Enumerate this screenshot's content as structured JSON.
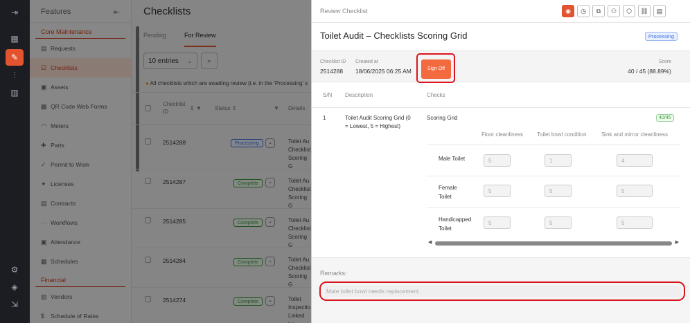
{
  "sidebar_features": {
    "title": "Features",
    "section_core": "Core Maintenance",
    "items": [
      "Requests",
      "Checklists",
      "Assets",
      "QR Code Web Forms",
      "Meters",
      "Parts",
      "Permit to Work",
      "Licenses",
      "Contracts",
      "Workflows",
      "Attendance",
      "Schedules"
    ],
    "section_financial": "Financial",
    "financial_items": [
      "Vendors",
      "Schedule of Rates"
    ]
  },
  "list": {
    "title": "Checklists",
    "tabs": [
      "Pending",
      "For Review"
    ],
    "entries_select": "10 entries",
    "note": "All checklists which are awaiting review (i.e. in the 'Processing' s",
    "columns": {
      "id": "Checklist ID",
      "status": "Status",
      "details": "Details"
    },
    "rows": [
      {
        "id": "2514288",
        "status": "Processing",
        "details": [
          "Toilet Au",
          "Checklist",
          "Scoring G"
        ]
      },
      {
        "id": "2514287",
        "status": "Complete",
        "details": [
          "Toilet Au",
          "Checklist",
          "Scoring G"
        ]
      },
      {
        "id": "2514285",
        "status": "Complete",
        "details": [
          "Toilet Au",
          "Checklist",
          "Scoring G"
        ]
      },
      {
        "id": "2514284",
        "status": "Complete",
        "details": [
          "Toilet Au",
          "Checklist",
          "Scoring G"
        ]
      },
      {
        "id": "2514274",
        "status": "Complete",
        "details": [
          "Toilet",
          "Inspectio",
          "Linked Lo"
        ]
      }
    ]
  },
  "panel": {
    "header_label": "Review Checklist",
    "title": "Toilet Audit – Checklists Scoring Grid",
    "status": "Processing",
    "info": {
      "checklist_id_label": "Checklist ID",
      "checklist_id": "2514288",
      "created_at_label": "Created at",
      "created_at": "18/06/2025 06:25 AM",
      "sign_off": "Sign Off",
      "score_label": "Score",
      "score": "40 / 45 (88.89%)"
    },
    "columns": {
      "sn": "S/N",
      "description": "Description",
      "checks": "Checks"
    },
    "item": {
      "sn": "1",
      "description_lines": [
        "Toilet Audit Scoring Grid (0",
        "= Lowest, 5 = Highest)"
      ],
      "check_name": "Scoring Grid",
      "check_score": "40/45",
      "grid_headers": [
        "Floor cleanliness",
        "Toilet bowl condition",
        "Sink and mirror cleanliness"
      ],
      "grid_rows": [
        {
          "label": [
            "Male Toilet"
          ],
          "values": [
            "5",
            "1",
            "4"
          ]
        },
        {
          "label": [
            "Female",
            "Toilet"
          ],
          "values": [
            "5",
            "5",
            "5"
          ]
        },
        {
          "label": [
            "Handicapped",
            "Toilet"
          ],
          "values": [
            "5",
            "5",
            "5"
          ]
        }
      ]
    },
    "remarks_label": "Remarks:",
    "remarks_placeholder": "Male toilet bowl needs replacement"
  },
  "colors": {
    "accent": "#e2542f",
    "highlight": "#d9141c",
    "processing": "#3a6ee0",
    "complete": "#3b9a3b"
  }
}
